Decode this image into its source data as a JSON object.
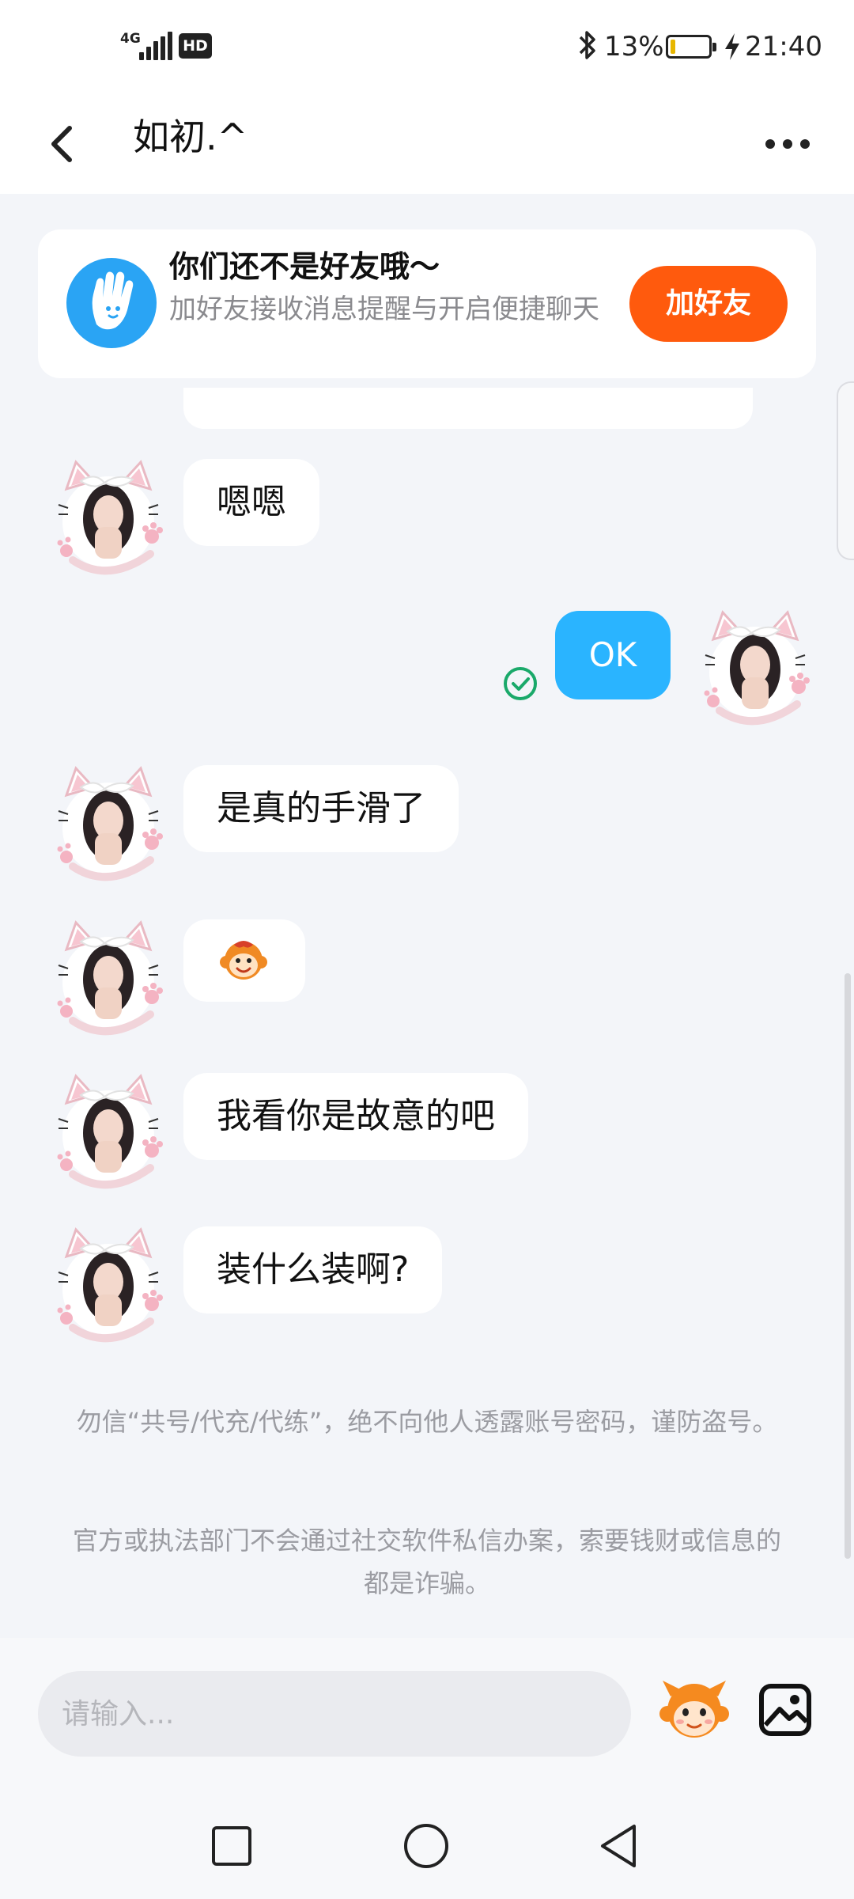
{
  "status_bar": {
    "network_type": "4G",
    "hd_label": "HD",
    "battery_percent": "13%",
    "battery_level": 0.13,
    "time": "21:40",
    "icons": [
      "signal-icon",
      "bluetooth-icon",
      "battery-icon",
      "charging-icon"
    ]
  },
  "header": {
    "title": "如初.^",
    "back_icon": "chevron-left-icon",
    "more_icon": "more-dots-icon"
  },
  "friend_banner": {
    "title": "你们还不是好友哦～",
    "description": "加好友接收消息提醒与开启便捷聊天",
    "button_label": "加好友",
    "button_color": "#ff5a0d",
    "icon": "wave-hand-icon"
  },
  "messages": [
    {
      "direction": "in",
      "text": "嗯嗯"
    },
    {
      "direction": "out",
      "text": "OK",
      "status": "read-check-icon"
    },
    {
      "direction": "in",
      "text": "是真的手滑了"
    },
    {
      "direction": "in",
      "emoji": "monkey-face-sticker"
    },
    {
      "direction": "in",
      "text": "我看你是故意的吧"
    },
    {
      "direction": "in",
      "text": "装什么装啊?"
    }
  ],
  "notices": [
    "勿信“共号/代充/代练”，绝不向他人透露账号密码，谨防盗号。",
    "官方或执法部门不会通过社交软件私信办案，索要钱财或信息的都是诈骗。"
  ],
  "input_bar": {
    "placeholder": "请输入...",
    "emoji_icon": "monkey-emoji-icon",
    "image_icon": "image-picker-icon"
  },
  "nav_bar": {
    "icons": [
      "recent-apps-square-icon",
      "home-circle-icon",
      "back-triangle-icon"
    ]
  },
  "colors": {
    "accent_blue": "#2ab4ff",
    "background": "#f3f5f9",
    "check_green": "#1aa96a"
  }
}
